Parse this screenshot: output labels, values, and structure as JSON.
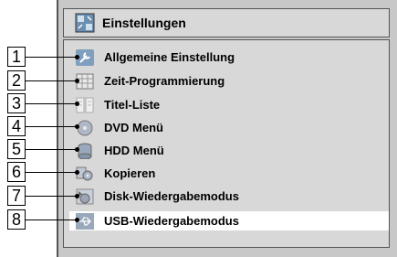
{
  "header": {
    "title": "Einstellungen",
    "icon": "settings-icon"
  },
  "menu": {
    "items": [
      {
        "number": "1",
        "label": "Allgemeine Einstellung",
        "icon": "wrench-icon"
      },
      {
        "number": "2",
        "label": "Zeit-Programmierung",
        "icon": "calendar-grid-icon"
      },
      {
        "number": "3",
        "label": "Titel-Liste",
        "icon": "title-list-icon"
      },
      {
        "number": "4",
        "label": "DVD Menü",
        "icon": "dvd-disc-icon"
      },
      {
        "number": "5",
        "label": "HDD Menü",
        "icon": "hdd-icon"
      },
      {
        "number": "6",
        "label": "Kopieren",
        "icon": "copy-icon"
      },
      {
        "number": "7",
        "label": "Disk-Wiedergabemodus",
        "icon": "disc-playback-icon"
      },
      {
        "number": "8",
        "label": "USB-Wiedergabemodus",
        "icon": "usb-icon"
      }
    ],
    "selected_index": 7
  },
  "colors": {
    "frame_bg": "#c8c8c8",
    "panel_bg": "#d8d8d8",
    "selected_bg": "#ffffff",
    "border": "#555555"
  }
}
